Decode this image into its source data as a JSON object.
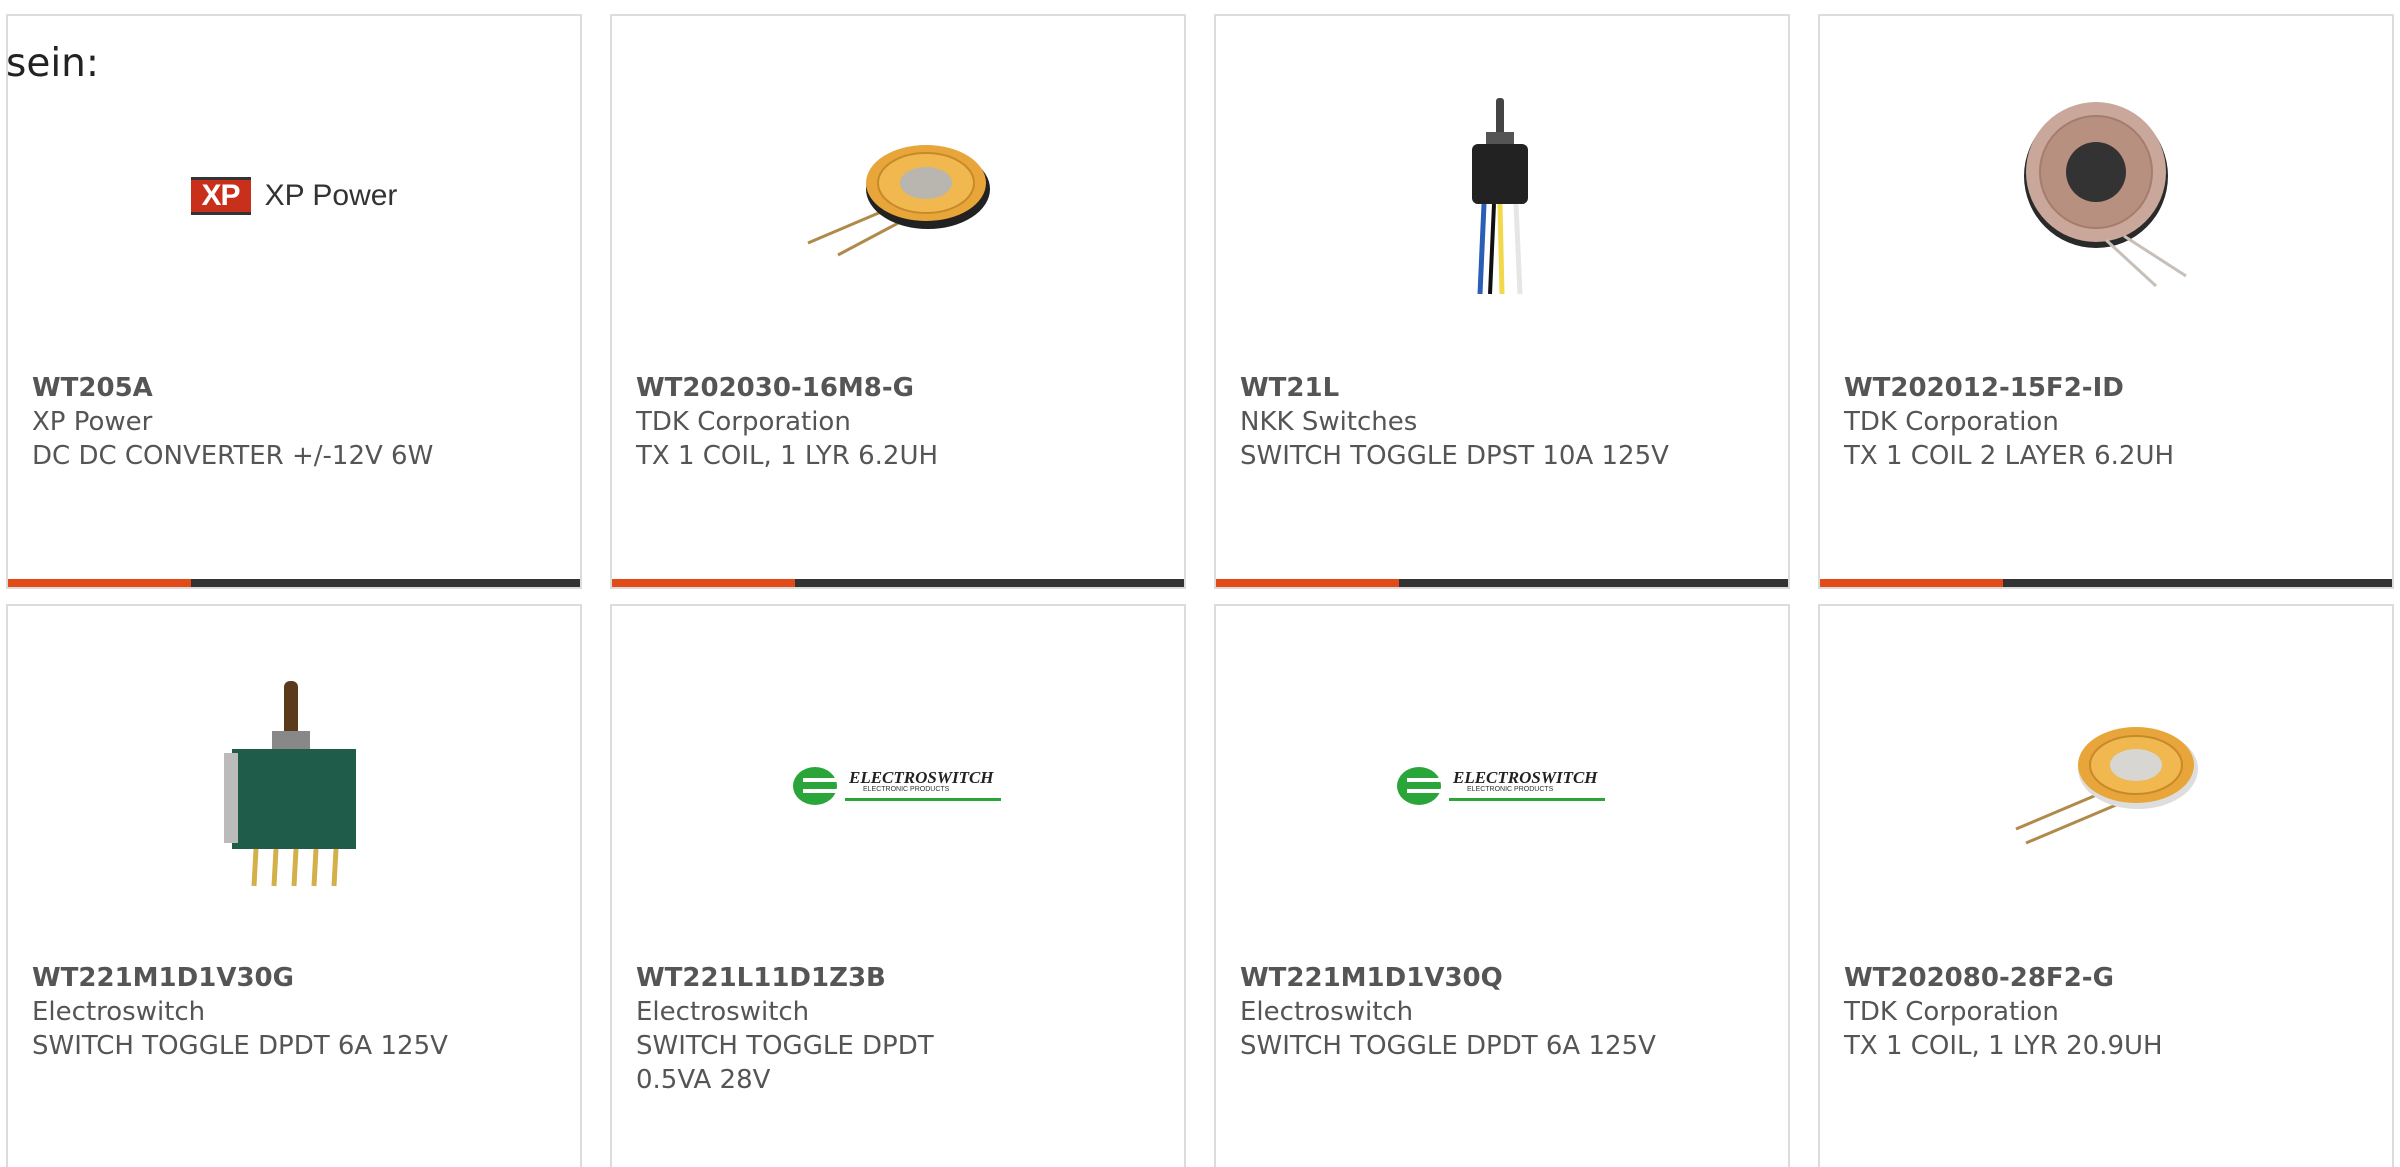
{
  "intro_text": "sein:",
  "colors": {
    "accent": "#e24a18",
    "bar": "#333333",
    "card_border": "#dcdcdc"
  },
  "products": [
    {
      "part_number": "WT205A",
      "manufacturer": "XP Power",
      "description": "DC DC CONVERTER +/-12V 6W",
      "image": "xp-power-logo",
      "logo_text": "XP Power",
      "logo_mark": "XP"
    },
    {
      "part_number": "WT202030-16M8-G",
      "manufacturer": "TDK Corporation",
      "description": "TX 1 COIL, 1 LYR 6.2UH",
      "image": "wireless-charging-coil"
    },
    {
      "part_number": "WT21L",
      "manufacturer": "NKK Switches",
      "description": "SWITCH TOGGLE DPST 10A 125V",
      "image": "toggle-switch-wired"
    },
    {
      "part_number": "WT202012-15F2-ID",
      "manufacturer": "TDK Corporation",
      "description": "TX 1 COIL 2 LAYER 6.2UH",
      "image": "coil-with-ferrite"
    },
    {
      "part_number": "WT221M1D1V30G",
      "manufacturer": "Electroswitch",
      "description": "SWITCH TOGGLE DPDT 6A 125V",
      "image": "toggle-switch-pcb"
    },
    {
      "part_number": "WT221L11D1Z3B",
      "manufacturer": "Electroswitch",
      "description": "SWITCH TOGGLE DPDT 0.5VA 28V",
      "image": "electroswitch-logo",
      "logo_text": "ELECTROSWITCH",
      "logo_sub": "ELECTRONIC PRODUCTS"
    },
    {
      "part_number": "WT221M1D1V30Q",
      "manufacturer": "Electroswitch",
      "description": "SWITCH TOGGLE DPDT 6A 125V",
      "image": "electroswitch-logo",
      "logo_text": "ELECTROSWITCH",
      "logo_sub": "ELECTRONIC PRODUCTS"
    },
    {
      "part_number": "WT202080-28F2-G",
      "manufacturer": "TDK Corporation",
      "description": "TX 1 COIL, 1 LYR 20.9UH",
      "image": "wireless-charging-coil"
    }
  ]
}
